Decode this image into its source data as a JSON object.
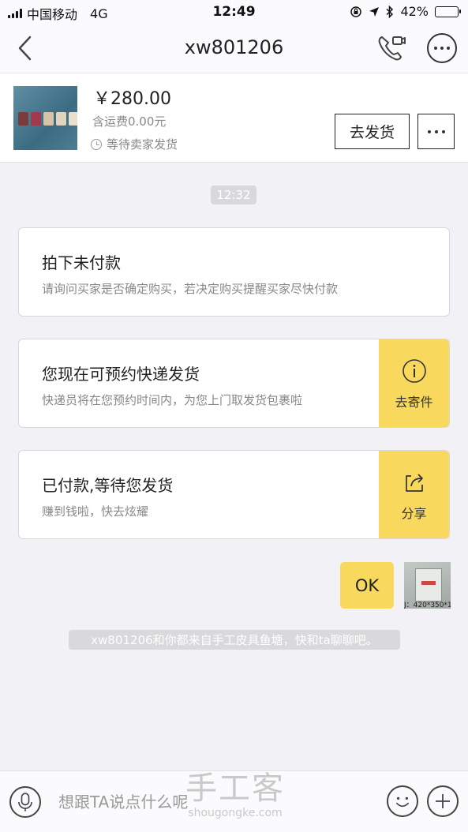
{
  "status_bar": {
    "carrier": "中国移动",
    "network": "4G",
    "time": "12:49",
    "battery_percent": "42%",
    "battery_level": 0.42
  },
  "nav": {
    "title": "xw801206",
    "icons": [
      "back-arrow-icon",
      "phone-video-call-icon",
      "more-options-icon"
    ]
  },
  "product": {
    "price": "￥280.00",
    "shipping_fee": "含运费0.00元",
    "order_status": "等待卖家发货",
    "ship_button": "去发货"
  },
  "chat": {
    "time_label": "12:32",
    "cards": [
      {
        "title": "拍下未付款",
        "desc": "请询问买家是否确定购买，若决定购买提醒买家尽快付款"
      },
      {
        "title": "您现在可预约快递发货",
        "desc": "快递员将在您预约时间内，为您上门取发货包裹啦",
        "action_label": "去寄件",
        "action_icon": "info-icon"
      },
      {
        "title": "已付款,等待您发货",
        "desc": "赚到钱啦，快去炫耀",
        "action_label": "分享",
        "action_icon": "share-icon"
      }
    ],
    "my_message": "OK",
    "avatar_caption": "J：420*350*1",
    "system_note": "xw801206和你都来自手工皮具鱼塘，快和ta聊聊吧。"
  },
  "input_bar": {
    "placeholder": "想跟TA说点什么呢"
  },
  "watermark": {
    "title": "手工客",
    "domain": "shougongke.com"
  },
  "colors": {
    "accent_yellow": "#f8d95e",
    "background": "#f2f2f6",
    "badge_gray": "#d9d9dc"
  }
}
